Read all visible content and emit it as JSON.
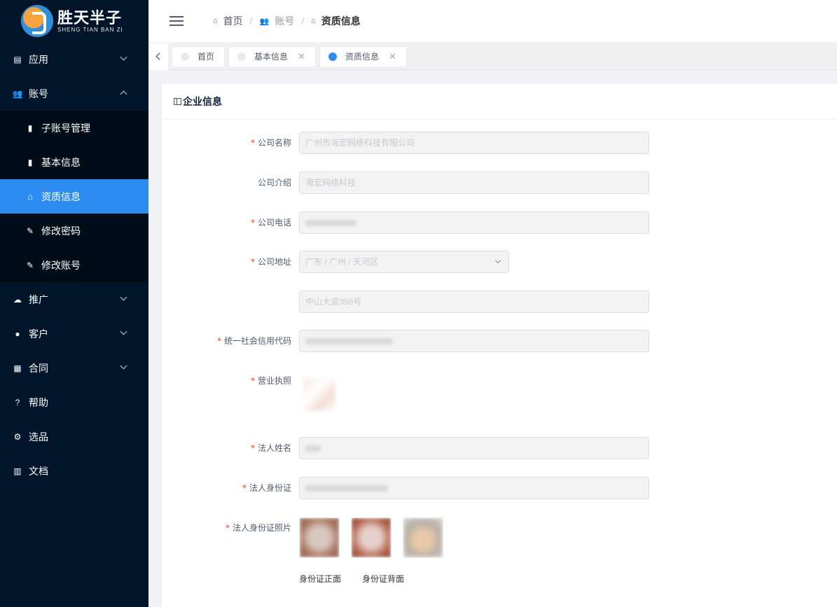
{
  "brand": {
    "name_cn": "胜天半子",
    "name_en": "SHENG TIAN  BAN ZI"
  },
  "sidebar": {
    "items": [
      {
        "label": "应用",
        "icon": "app-icon",
        "expanded": false
      },
      {
        "label": "账号",
        "icon": "users-icon",
        "expanded": true,
        "children": [
          {
            "label": "子账号管理",
            "icon": "file-icon"
          },
          {
            "label": "基本信息",
            "icon": "file-icon"
          },
          {
            "label": "资质信息",
            "icon": "home-icon",
            "active": true
          },
          {
            "label": "修改密码",
            "icon": "brush-icon"
          },
          {
            "label": "修改账号",
            "icon": "brush-icon"
          }
        ]
      },
      {
        "label": "推广",
        "icon": "cloud-upload-icon",
        "expanded": false
      },
      {
        "label": "客户",
        "icon": "person-icon",
        "expanded": false
      },
      {
        "label": "合同",
        "icon": "document-icon",
        "expanded": false
      },
      {
        "label": "帮助",
        "icon": "help-icon"
      },
      {
        "label": "选品",
        "icon": "gear-icon"
      },
      {
        "label": "文档",
        "icon": "book-icon"
      }
    ]
  },
  "header": {
    "breadcrumb": [
      {
        "label": "首页",
        "icon": "home-icon"
      },
      {
        "label": "账号",
        "icon": "users-icon"
      },
      {
        "label": "资质信息",
        "icon": "home-icon"
      }
    ]
  },
  "tabs": [
    {
      "label": "首页",
      "closable": false,
      "active": false
    },
    {
      "label": "基本信息",
      "closable": true,
      "active": false
    },
    {
      "label": "资质信息",
      "closable": true,
      "active": true
    }
  ],
  "card": {
    "title": "企业信息",
    "fields": {
      "company_name": {
        "label": "公司名称",
        "required": true,
        "value": "广州市海宏网络科技有限公司"
      },
      "company_intro": {
        "label": "公司介绍",
        "required": false,
        "value": "海宏网络科技"
      },
      "company_phone": {
        "label": "公司电话",
        "required": true,
        "value": ""
      },
      "company_address": {
        "label": "公司地址",
        "required": true,
        "value": "广东 / 广州 / 天河区"
      },
      "address_detail": {
        "label": "",
        "required": false,
        "value": "中山大道398号"
      },
      "credit_code": {
        "label": "统一社会信用代码",
        "required": true,
        "value": ""
      },
      "license": {
        "label": "营业执照",
        "required": true
      },
      "legal_name": {
        "label": "法人姓名",
        "required": true,
        "value": ""
      },
      "legal_id": {
        "label": "法人身份证",
        "required": true,
        "value": ""
      },
      "legal_id_photos": {
        "label": "法人身份证照片",
        "required": true,
        "captions": [
          "身份证正面",
          "身份证背面"
        ]
      }
    }
  },
  "colors": {
    "sidebar_bg": "#001529",
    "submenu_bg": "#000c17",
    "accent": "#2d8cf0",
    "required": "#ed4014"
  }
}
